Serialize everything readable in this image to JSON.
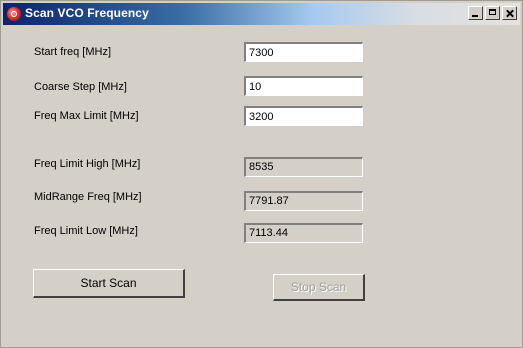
{
  "window": {
    "title": "Scan VCO Frequency",
    "icon": "app-icon",
    "controls": {
      "minimize": "minimize-icon",
      "maximize": "maximize-icon",
      "close": "close-icon"
    }
  },
  "inputs": [
    {
      "label": "Start freq [MHz]",
      "value": "7300"
    },
    {
      "label": "Coarse Step [MHz]",
      "value": "10"
    },
    {
      "label": "Freq Max Limit [MHz]",
      "value": "3200"
    }
  ],
  "outputs": [
    {
      "label": "Freq  Limit High [MHz]",
      "value": "8535"
    },
    {
      "label": "MidRange Freq [MHz]",
      "value": "7791.87"
    },
    {
      "label": "Freq  Limit Low [MHz]",
      "value": "7113.44"
    }
  ],
  "buttons": {
    "start": "Start Scan",
    "stop": "Stop Scan"
  }
}
